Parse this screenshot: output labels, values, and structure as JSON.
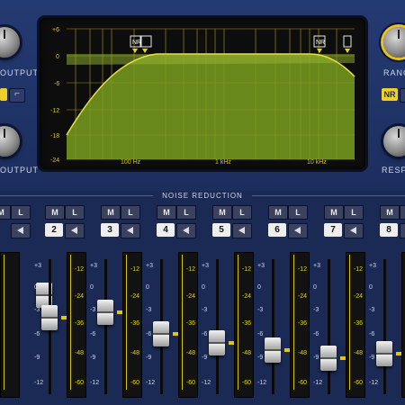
{
  "left_panel": {
    "output_label": "OUTPUT",
    "output_label_bottom": "OUTPUT"
  },
  "right_panel": {
    "range_label": "RANG",
    "response_label": "RESPO",
    "nr_button": "NR"
  },
  "screen": {
    "y_ticks": [
      "+6",
      "0",
      "-6",
      "-12",
      "-18",
      "-24"
    ],
    "x_labels": [
      "100 Hz",
      "1 kHz",
      "10 kHz"
    ],
    "markers": [
      "NR",
      "NR"
    ]
  },
  "section_title": "NOISE REDUCTION",
  "channels": [
    {
      "number": "2",
      "m": "M",
      "l": "L",
      "gr_level": 0.42
    },
    {
      "number": "3",
      "m": "M",
      "l": "L",
      "gr_level": 0.38
    },
    {
      "number": "4",
      "m": "M",
      "l": "L",
      "gr_level": 0.55
    },
    {
      "number": "5",
      "m": "M",
      "l": "L",
      "gr_level": 0.62
    },
    {
      "number": "6",
      "m": "M",
      "l": "L",
      "gr_level": 0.68
    },
    {
      "number": "7",
      "m": "M",
      "l": "L",
      "gr_level": 0.74
    },
    {
      "number": "8",
      "m": "M",
      "l": "L",
      "gr_level": 0.71
    }
  ],
  "fader_scale": [
    "+3",
    "0",
    "-3",
    "-6",
    "-9",
    "-12"
  ],
  "meter_scale": [
    "-12",
    "-24",
    "-36",
    "-48",
    "-60"
  ],
  "colors": {
    "accent": "#f1cf2a",
    "panel": "#1c2e5e",
    "curve_fill": "#7ea524"
  }
}
